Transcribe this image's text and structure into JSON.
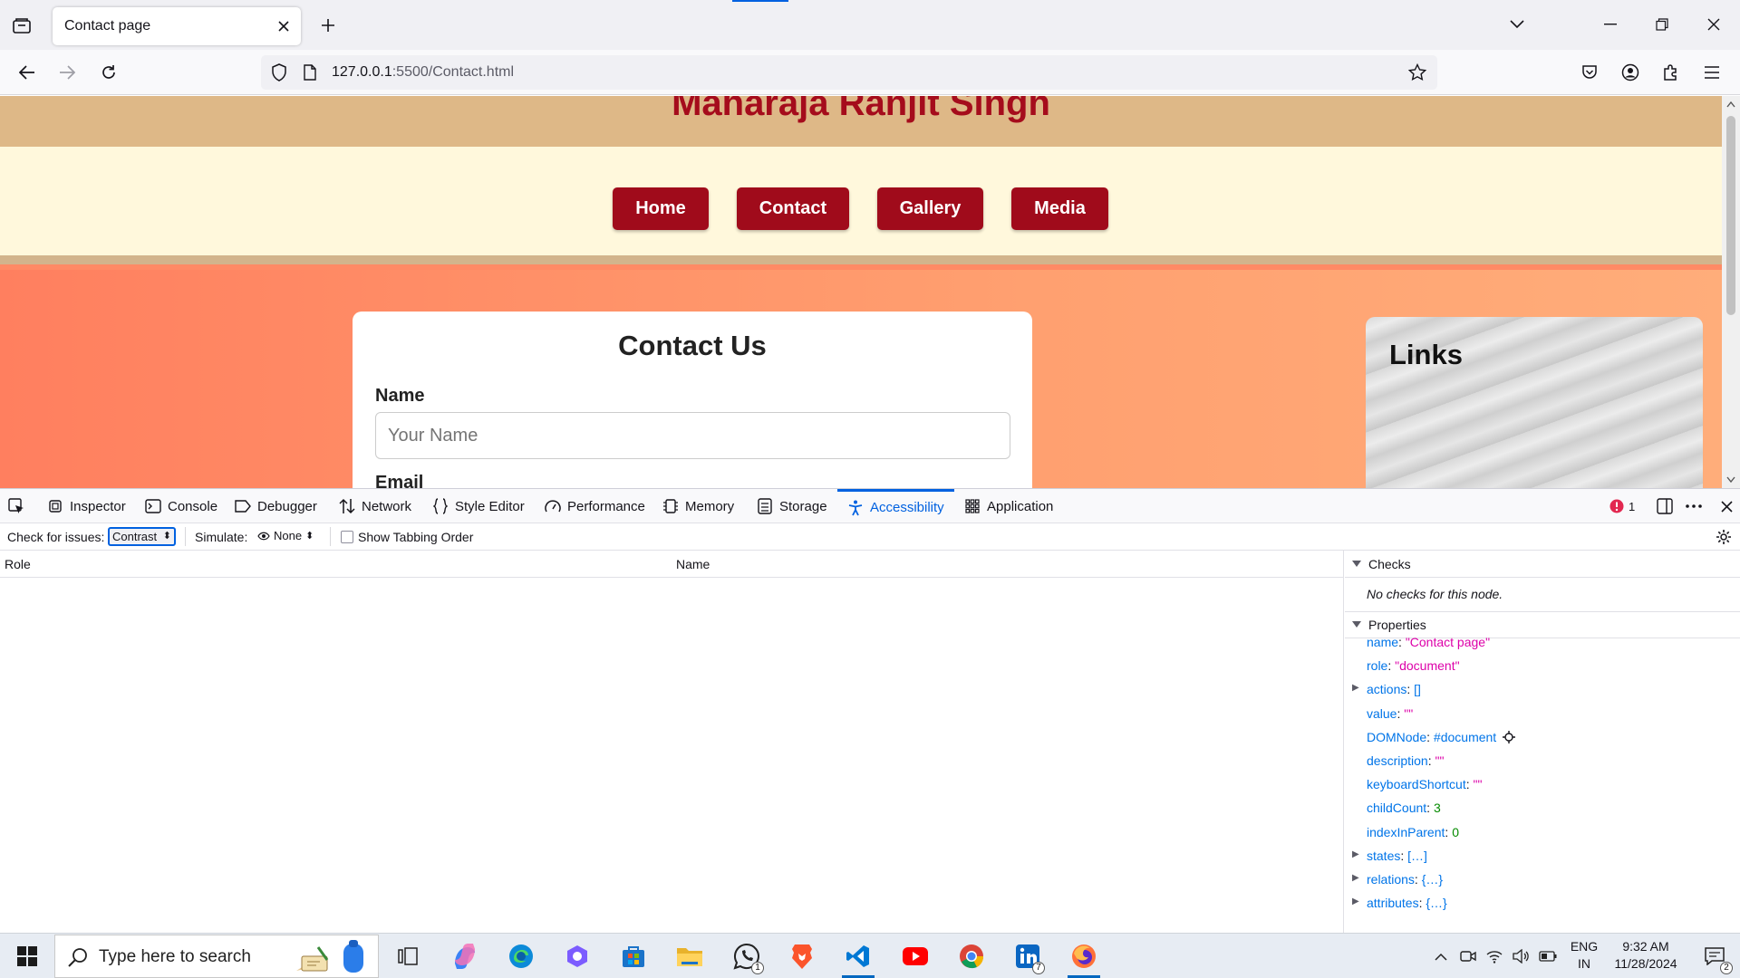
{
  "browser": {
    "tab_title": "Contact page",
    "url_host": "127.0.0.1",
    "url_rest": ":5500/Contact.html"
  },
  "site": {
    "title": "Maharaja Ranjit Singh",
    "nav": [
      "Home",
      "Contact",
      "Gallery",
      "Media"
    ],
    "contact_heading": "Contact Us",
    "name_label": "Name",
    "name_placeholder": "Your Name",
    "email_label_partial": "Email",
    "links_heading": "Links"
  },
  "devtools": {
    "tabs": [
      "Inspector",
      "Console",
      "Debugger",
      "Network",
      "Style Editor",
      "Performance",
      "Memory",
      "Storage",
      "Accessibility",
      "Application"
    ],
    "active_tab": "Accessibility",
    "error_count": "1",
    "check_for_issues_label": "Check for issues:",
    "check_for_issues_value": "Contrast",
    "simulate_label": "Simulate:",
    "simulate_value": "None",
    "show_tabbing_order": "Show Tabbing Order",
    "col_role": "Role",
    "col_name": "Name",
    "checks_title": "Checks",
    "checks_empty": "No checks for this node.",
    "properties_title": "Properties",
    "properties": [
      {
        "key": "name",
        "value": "\"Contact page\"",
        "kind": "string"
      },
      {
        "key": "role",
        "value": "\"document\"",
        "kind": "string"
      },
      {
        "key": "actions",
        "value": "[]",
        "kind": "object",
        "expandable": true
      },
      {
        "key": "value",
        "value": "\"\"",
        "kind": "string"
      },
      {
        "key": "DOMNode",
        "value": "#document",
        "kind": "node"
      },
      {
        "key": "description",
        "value": "\"\"",
        "kind": "string"
      },
      {
        "key": "keyboardShortcut",
        "value": "\"\"",
        "kind": "string"
      },
      {
        "key": "childCount",
        "value": "3",
        "kind": "number"
      },
      {
        "key": "indexInParent",
        "value": "0",
        "kind": "number"
      },
      {
        "key": "states",
        "value": "[…]",
        "kind": "object",
        "expandable": true
      },
      {
        "key": "relations",
        "value": "{…}",
        "kind": "object",
        "expandable": true
      },
      {
        "key": "attributes",
        "value": "{…}",
        "kind": "object",
        "expandable": true
      }
    ]
  },
  "taskbar": {
    "search_placeholder": "Type here to search",
    "lang_top": "ENG",
    "lang_bottom": "IN",
    "time": "9:32 AM",
    "date": "11/28/2024",
    "notification_count": "2",
    "whatsapp_badge": "1",
    "linkedin_badge": "7"
  },
  "colors": {
    "accent": "#0061e0",
    "site_red": "#a00b1b",
    "header_tan": "#deb887",
    "nav_cream": "#fff8dc",
    "main_coral": "#ff8a65"
  }
}
